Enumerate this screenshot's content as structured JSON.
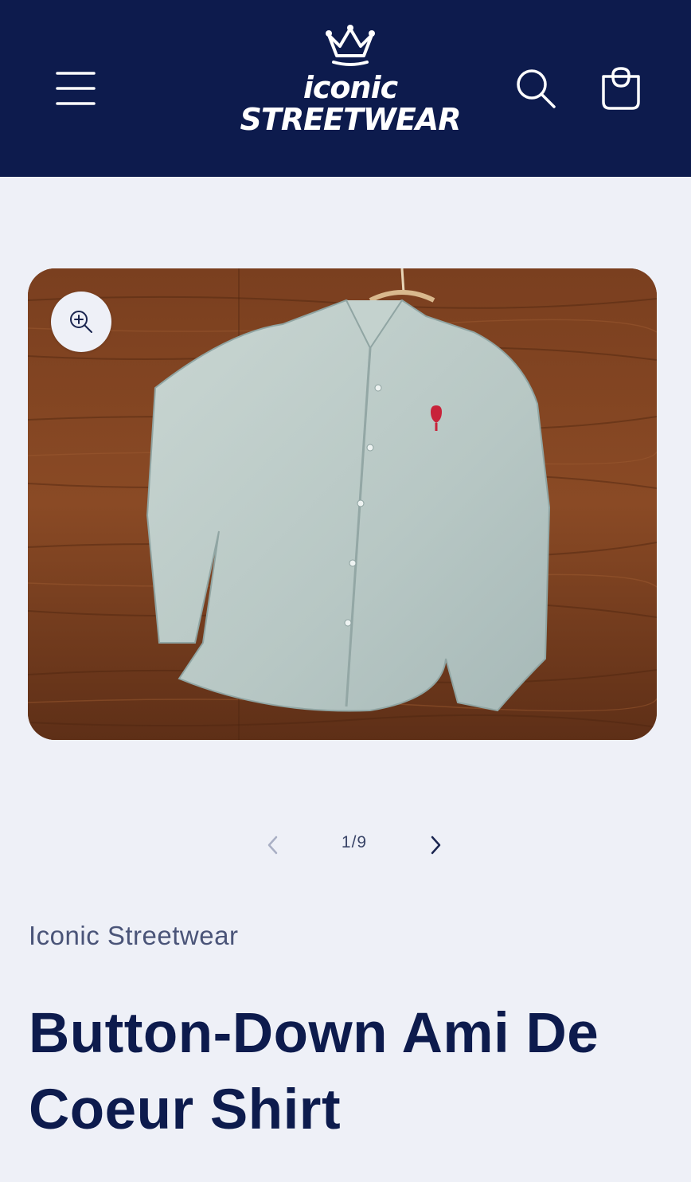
{
  "header": {
    "logo_line1": "iconic",
    "logo_line2": "STREETWEAR",
    "menu_icon": "hamburger-menu-icon",
    "search_icon": "search-icon",
    "cart_icon": "shopping-bag-icon",
    "background": "#0d1b4d"
  },
  "gallery": {
    "zoom_icon": "zoom-in-icon",
    "image_alt": "Light denim button-down shirt with red heart logo on wooden floor"
  },
  "pager": {
    "count": "1/9",
    "prev_icon": "chevron-left-icon",
    "next_icon": "chevron-right-icon"
  },
  "product": {
    "vendor": "Iconic Streetwear",
    "title": "Button-Down Ami De Coeur Shirt"
  },
  "colors": {
    "brand": "#0d1b4d",
    "page_bg": "#eef0f7",
    "muted_text": "#4a5478"
  }
}
